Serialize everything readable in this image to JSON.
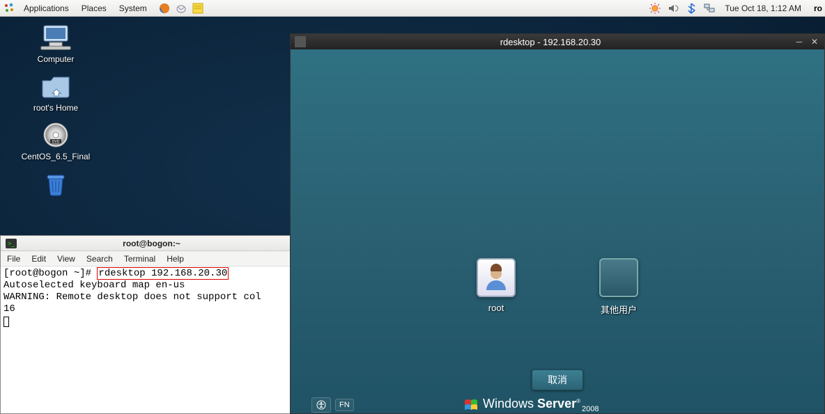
{
  "panel": {
    "menus": {
      "apps": "Applications",
      "places": "Places",
      "system": "System"
    },
    "clock": "Tue Oct 18,  1:12 AM",
    "user": "ro"
  },
  "desktop_icons": {
    "computer": "Computer",
    "home": "root's Home",
    "centos": "CentOS_6.5_Final",
    "trash": ""
  },
  "terminal": {
    "title": "root@bogon:~",
    "menubar": {
      "file": "File",
      "edit": "Edit",
      "view": "View",
      "search": "Search",
      "terminal": "Terminal",
      "help": "Help"
    },
    "prompt": "[root@bogon ~]# ",
    "cmd": "rdesktop 192.168.20.30",
    "out1": "Autoselected keyboard map en-us",
    "out2": "WARNING: Remote desktop does not support col",
    "out3": "16"
  },
  "rdesktop": {
    "title": "rdesktop - 192.168.20.30",
    "users": {
      "root": "root",
      "other": "其他用户"
    },
    "cancel": "取消",
    "branding": {
      "windows": "Windows",
      "server": " Server",
      "year": "2008"
    },
    "lang": "FN"
  }
}
